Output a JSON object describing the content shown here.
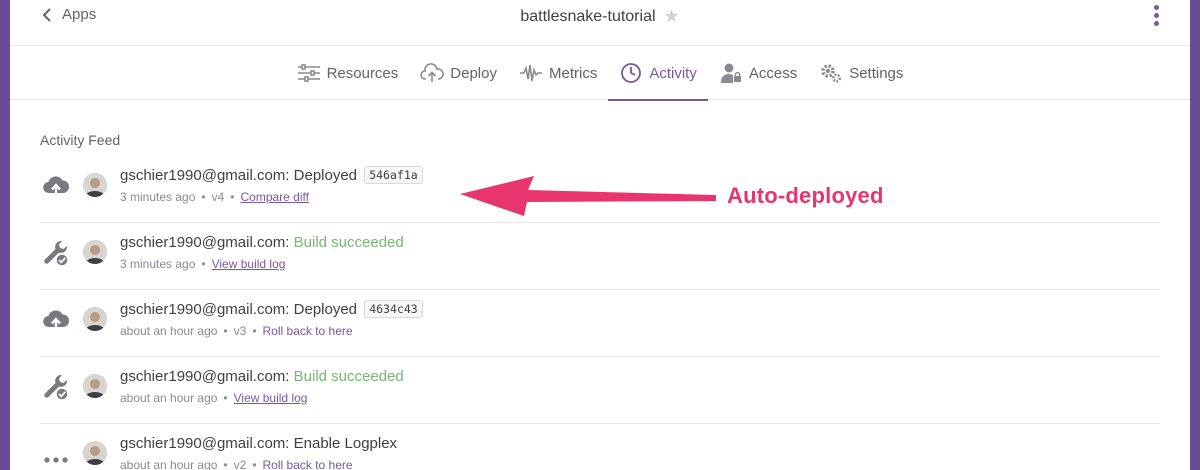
{
  "header": {
    "back_label": "Apps",
    "app_name": "battlesnake-tutorial"
  },
  "tabs": [
    {
      "label": "Resources",
      "icon": "sliders-icon"
    },
    {
      "label": "Deploy",
      "icon": "cloud-upload-icon"
    },
    {
      "label": "Metrics",
      "icon": "pulse-icon"
    },
    {
      "label": "Activity",
      "icon": "clock-icon",
      "active": true
    },
    {
      "label": "Access",
      "icon": "user-lock-icon"
    },
    {
      "label": "Settings",
      "icon": "gears-icon"
    }
  ],
  "feed": {
    "title": "Activity Feed",
    "items": [
      {
        "icon": "cloud-upload-icon",
        "user": "gschier1990@gmail.com:",
        "action": "Deployed",
        "sha": "546af1a",
        "time": "3 minutes ago",
        "version": "v4",
        "link": "Compare diff"
      },
      {
        "icon": "wrench-check-icon",
        "user": "gschier1990@gmail.com:",
        "status": "Build succeeded",
        "time": "3 minutes ago",
        "link": "View build log"
      },
      {
        "icon": "cloud-upload-icon",
        "user": "gschier1990@gmail.com:",
        "action": "Deployed",
        "sha": "4634c43",
        "time": "about an hour ago",
        "version": "v3",
        "link": "Roll back to here"
      },
      {
        "icon": "wrench-check-icon",
        "user": "gschier1990@gmail.com:",
        "status": "Build succeeded",
        "time": "about an hour ago",
        "link": "View build log"
      },
      {
        "icon": "ellipsis-icon",
        "user": "gschier1990@gmail.com:",
        "action": "Enable Logplex",
        "time": "about an hour ago",
        "version": "v2",
        "link": "Roll back to here"
      }
    ]
  },
  "annotation": {
    "text": "Auto-deployed",
    "color": "#e8356e"
  },
  "colors": {
    "accent": "#79589f",
    "success": "#74b96f",
    "frame": "#6a4c93"
  }
}
